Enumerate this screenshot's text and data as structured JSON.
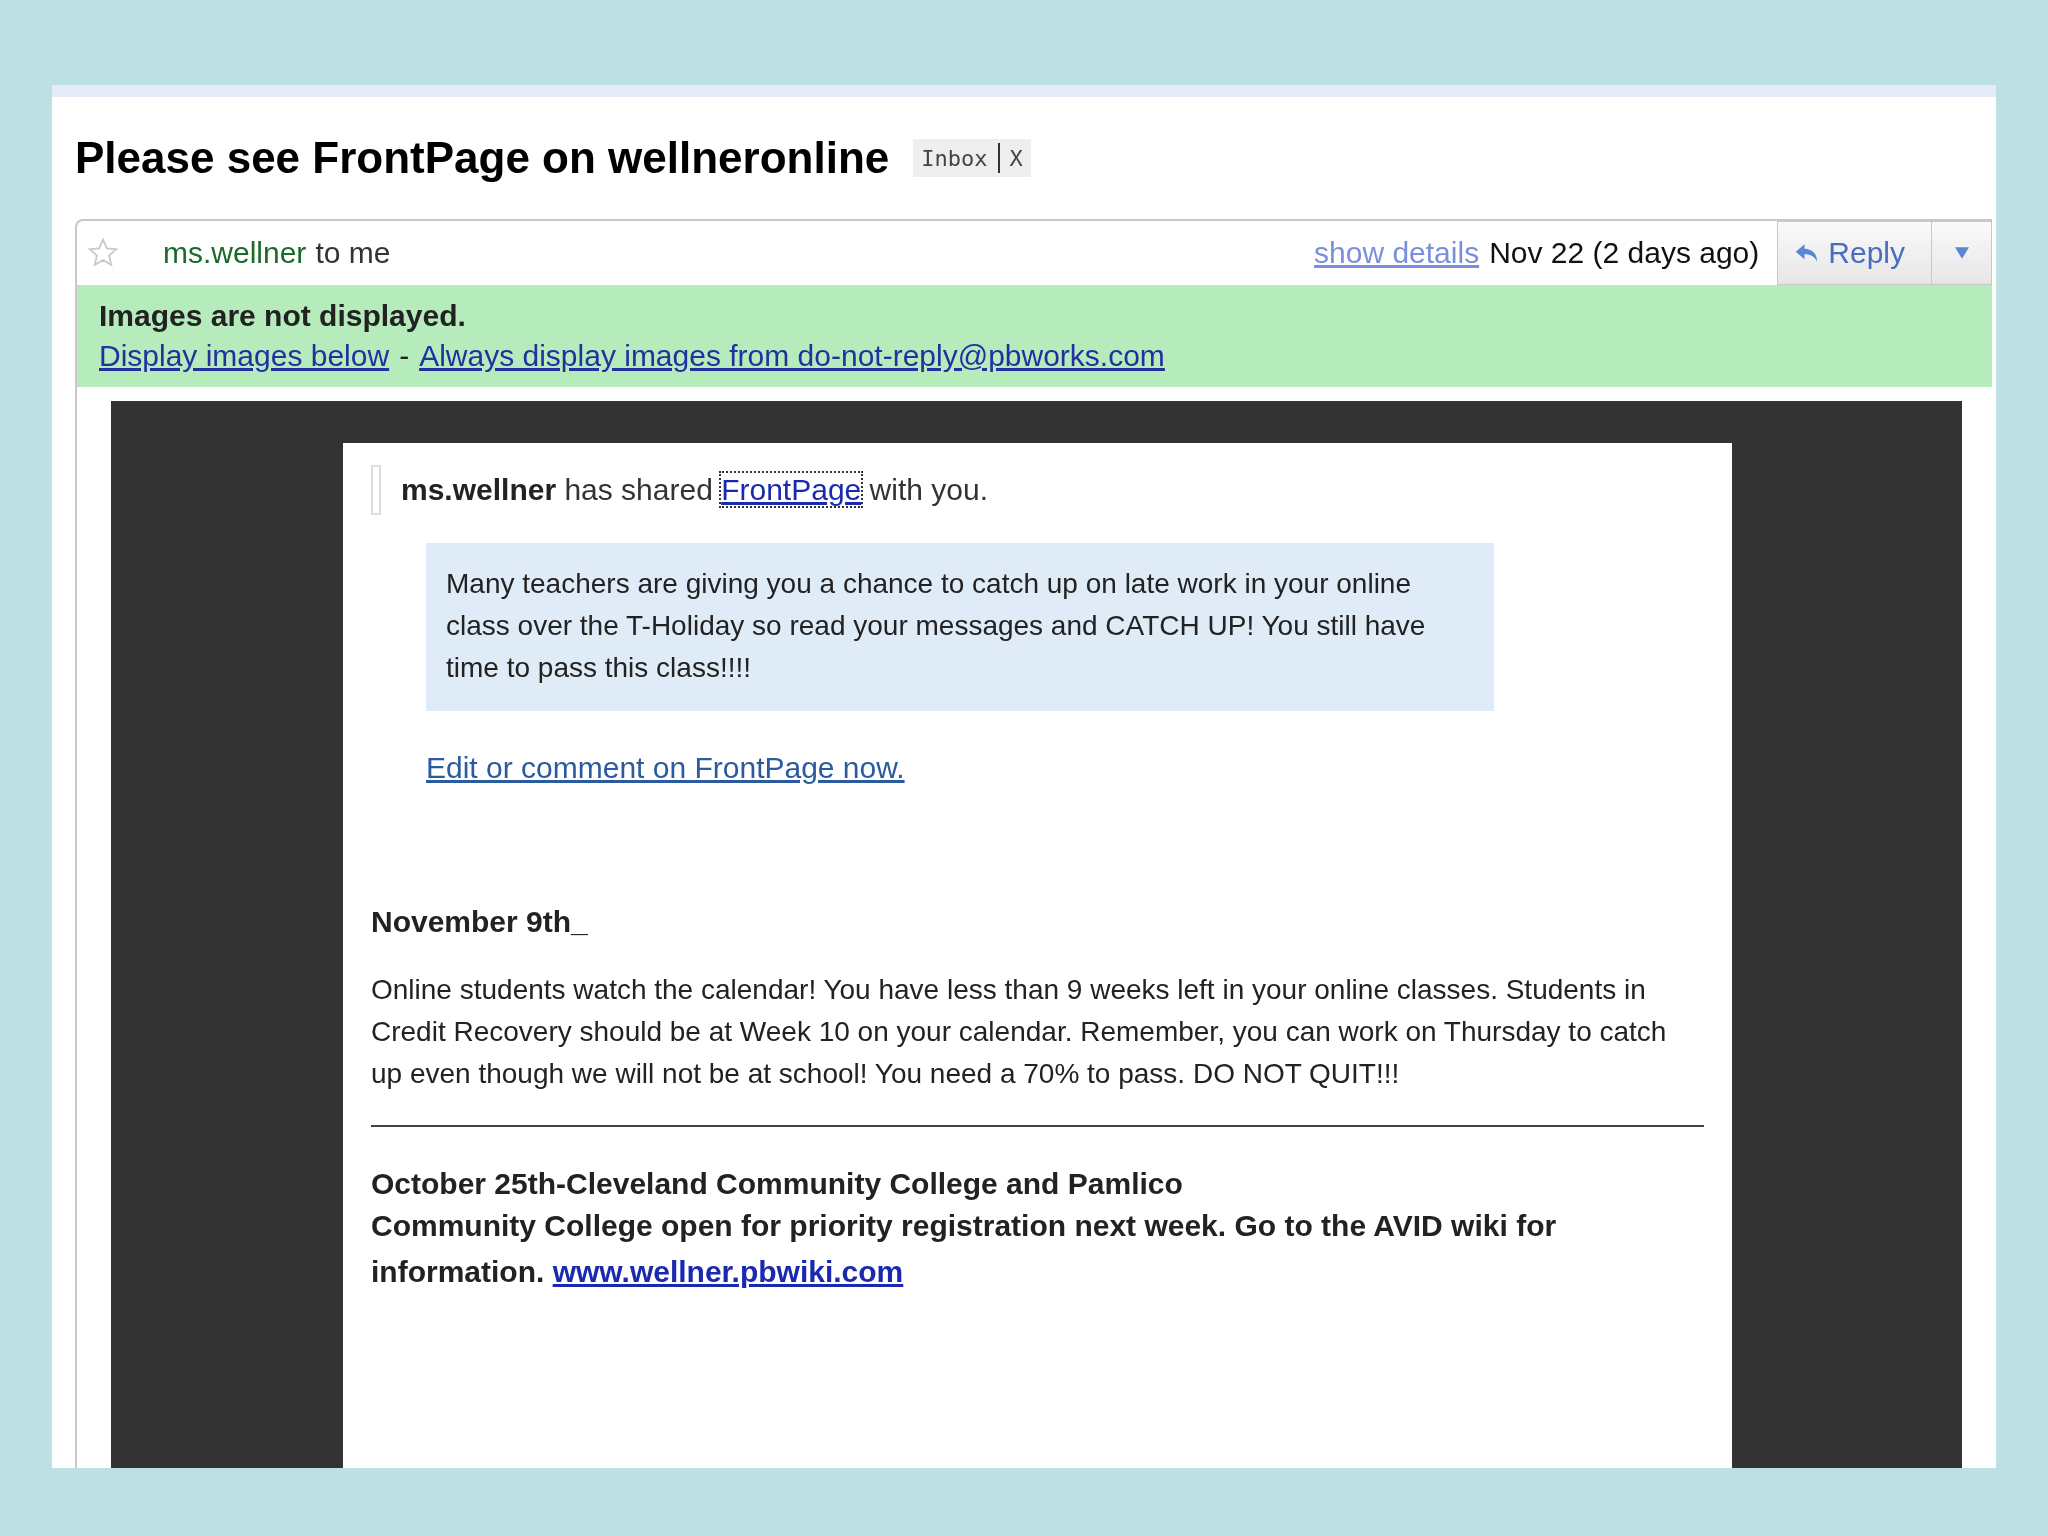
{
  "subject": {
    "title": "Please see FrontPage on wellneronline",
    "label": "Inbox",
    "remove": "X"
  },
  "message": {
    "starred": false,
    "sender": "ms.wellner",
    "recipient": "to me",
    "show_details": "show details",
    "date": "Nov 22 (2 days ago)",
    "reply": "Reply"
  },
  "images_notice": {
    "text": "Images are not displayed.",
    "display_link": "Display images below",
    "separator": "-",
    "always_link": "Always display images from do-not-reply@pbworks.com"
  },
  "body": {
    "share": {
      "user": "ms.wellner",
      "before": "has shared",
      "page": "FrontPage",
      "after": "with you."
    },
    "note": "Many teachers are giving you a chance to catch up on late work in your online class over the T-Holiday so read your messages and CATCH UP! You still have time to pass this class!!!!",
    "edit_link": "Edit or comment on FrontPage now.",
    "sections": [
      {
        "kind": "plain",
        "heading": "November 9th_",
        "text": "Online students watch the calendar! You have less than 9 weeks left in your online classes. Students in Credit Recovery should be at Week 10 on your calendar. Remember, you can work on Thursday to catch up even though we will not be at school! You need a 70% to pass. DO NOT QUIT!!!"
      },
      {
        "kind": "bold",
        "heading": "October 25th-Cleveland Community College and Pamlico",
        "text": "Community College open for priority registration next week. Go to the AVID wiki for information.",
        "link": "www.wellner.pbwiki.com"
      }
    ]
  }
}
